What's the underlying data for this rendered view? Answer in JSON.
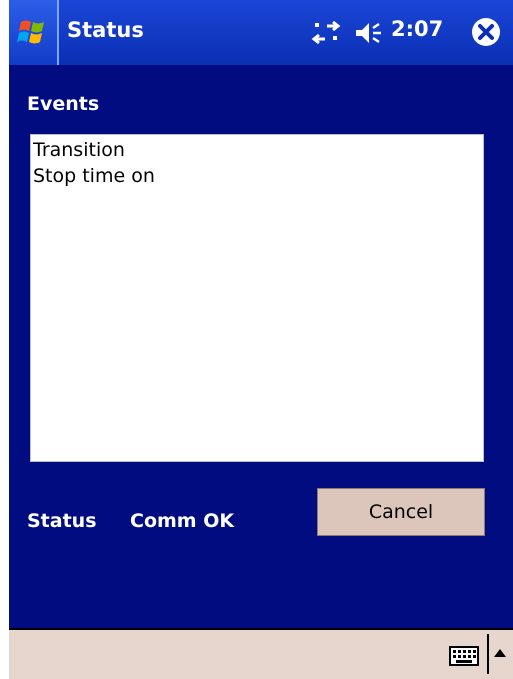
{
  "window": {
    "title": "Status",
    "clock": "2:07"
  },
  "icons": {
    "start": "windows-flag-icon",
    "sync": "sync-arrows-icon",
    "speaker": "speaker-volume-icon",
    "close": "close-circle-icon",
    "keyboard": "keyboard-icon",
    "sip_arrow": "up-triangle-icon"
  },
  "main": {
    "events_label": "Events",
    "events": [
      "Transition",
      "Stop time on"
    ],
    "status_label": "Status",
    "status_value": "Comm OK",
    "cancel_label": "Cancel"
  },
  "colors": {
    "titlebar": "#0b2fb4",
    "background": "#000c80",
    "button": "#dcc6bb",
    "menubar": "#e6d6cd"
  }
}
